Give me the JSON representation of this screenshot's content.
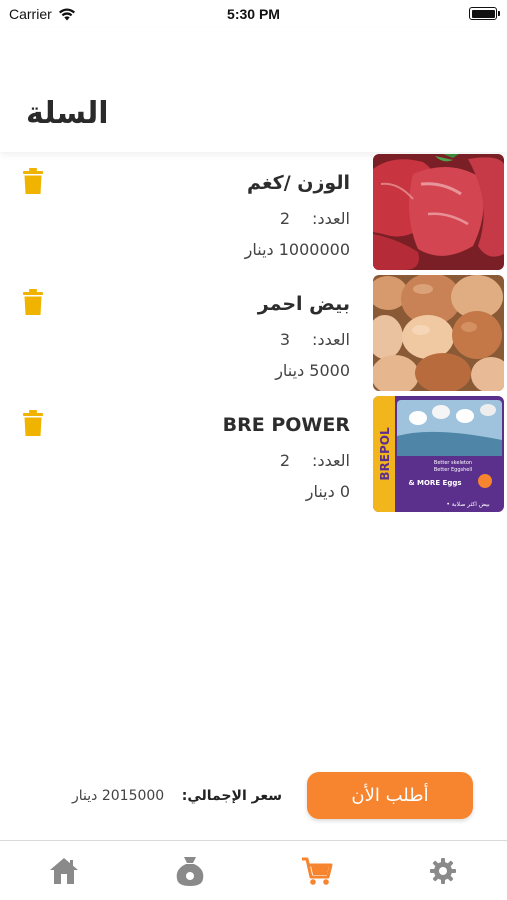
{
  "status_bar": {
    "carrier": "Carrier",
    "time": "5:30 PM"
  },
  "header": {
    "title": "السلة"
  },
  "cart": {
    "quantity_label": "العدد:",
    "items": [
      {
        "name": "الوزن /كغم",
        "quantity": "2",
        "price": "1000000 دينار",
        "image": "raw-meat-photo"
      },
      {
        "name": "بيض احمر",
        "quantity": "3",
        "price": "5000 دينار",
        "image": "brown-eggs-photo"
      },
      {
        "name": "BRE POWER",
        "quantity": "2",
        "price": "0 دينار",
        "image": "brepol-product-poster",
        "poster": {
          "brand": "BREPOL",
          "line1": "Better skeleton",
          "line2": "Better Eggshell",
          "line3": "& MORE Eggs",
          "line4": "• بيض اكثر صلابة"
        }
      }
    ]
  },
  "footer": {
    "order_button": "أطلب الأن",
    "total_label": "سعر الإجمالي:",
    "total_value": "2015000 دينار"
  },
  "tabs": [
    {
      "icon": "home-icon",
      "active": false
    },
    {
      "icon": "money-bag-icon",
      "active": false
    },
    {
      "icon": "cart-icon",
      "active": true
    },
    {
      "icon": "gear-icon",
      "active": false
    }
  ],
  "colors": {
    "accent": "#F7852F",
    "trash": "#F0B400",
    "tab_inactive": "#8a8a8a"
  }
}
